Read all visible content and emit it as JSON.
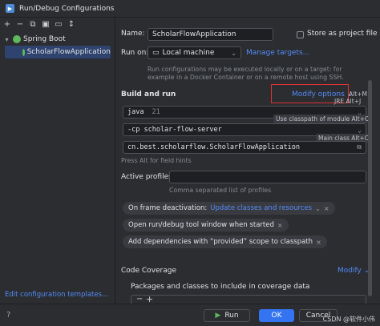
{
  "window": {
    "title": "Run/Debug Configurations"
  },
  "toolbar": {
    "add": "+",
    "remove": "−",
    "copy": "⧉",
    "save": "▣",
    "folder": "▭",
    "sort": "↕"
  },
  "tree": {
    "root_label": "Spring Boot",
    "child_label": "ScholarFlowApplication",
    "edit_templates": "Edit configuration templates..."
  },
  "form": {
    "name_label": "Name:",
    "name_value": "ScholarFlowApplication",
    "store_label": "Store as project file",
    "run_on_label": "Run on:",
    "run_on_value": "Local machine",
    "manage_targets": "Manage targets...",
    "run_hint_1": "Run configurations may be executed locally or on a target: for",
    "run_hint_2": "example in a Docker Container or on a remote host using SSH.",
    "build_run_label": "Build and run",
    "modify_options": "Modify options",
    "alt_m": "Alt+M",
    "jre_alt_j": "JRE Alt+J",
    "java_label": "java",
    "java_version": "21",
    "classpath_tip": "Use classpath of module Alt+C",
    "cp_value": "-cp scholar-flow-server",
    "main_class_tip": "Main class Alt+C",
    "main_class_value": "cn.best.scholarflow.ScholarFlowApplication",
    "field_hints": "Press Alt for field hints",
    "active_profiles_label": "Active profiles:",
    "profiles_hint": "Comma separated list of profiles",
    "chip1_prefix": "On frame deactivation:",
    "chip1_link": "Update classes and resources",
    "chip2": "Open run/debug tool window when started",
    "chip3": "Add dependencies with “provided” scope to classpath",
    "code_coverage_label": "Code Coverage",
    "modify_short": "Modify",
    "packages_label": "Packages and classes to include in coverage data"
  },
  "buttons": {
    "run": "Run",
    "ok": "OK",
    "cancel": "Cancel"
  },
  "watermark": "CSDN @软件小伟",
  "colors": {
    "accent": "#548af7",
    "primary_button": "#3574f0",
    "selection": "#2e436e",
    "highlight_box": "#e0312f"
  }
}
